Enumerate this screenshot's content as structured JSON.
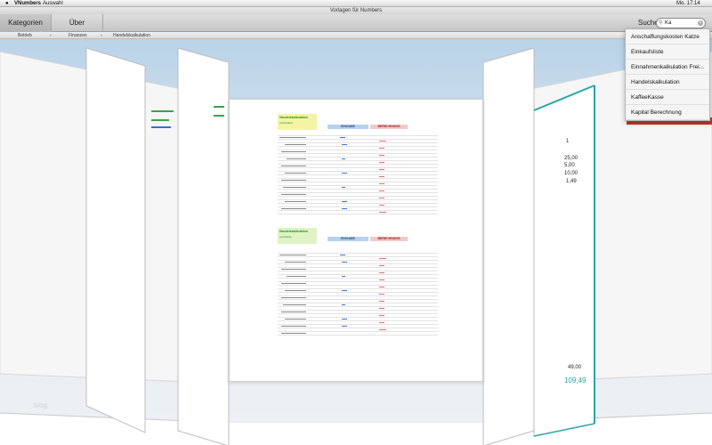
{
  "menubar": {
    "app": "VNumbers",
    "menu": "Auswahl",
    "clock": "Mo. 17:14"
  },
  "window": {
    "title": "Vorlagen für Numbers"
  },
  "toolbar": {
    "tab_categories": "Kategorien",
    "tab_about": "Über",
    "search_label": "Suche",
    "search_value": "Ka"
  },
  "breadcrumb": {
    "item1": "Betrieb",
    "item2": "Finanzen",
    "item3": "Handelskalkulation"
  },
  "dropdown": {
    "items": [
      "Anschaffungskosten Katze",
      "Einkaufsliste",
      "Einnahmenkalkulation Frei...",
      "Handelskalkulation",
      "KaffeeKasse",
      "Kapital Berechnung"
    ]
  },
  "sheet": {
    "title1": "Handelskalkulation",
    "subtitle1": "(rückwärts)",
    "title2": "Handelskalkulation",
    "subtitle2": "(vorwärts)",
    "col_input": "EINGABE",
    "col_calc": "BERECHNUNG"
  },
  "right_card": {
    "values": [
      "25,00",
      "5,00",
      "10,00",
      "1,49"
    ],
    "total_a": "49,00",
    "total_b": "109,49",
    "count": "1"
  },
  "watermark": "blog"
}
